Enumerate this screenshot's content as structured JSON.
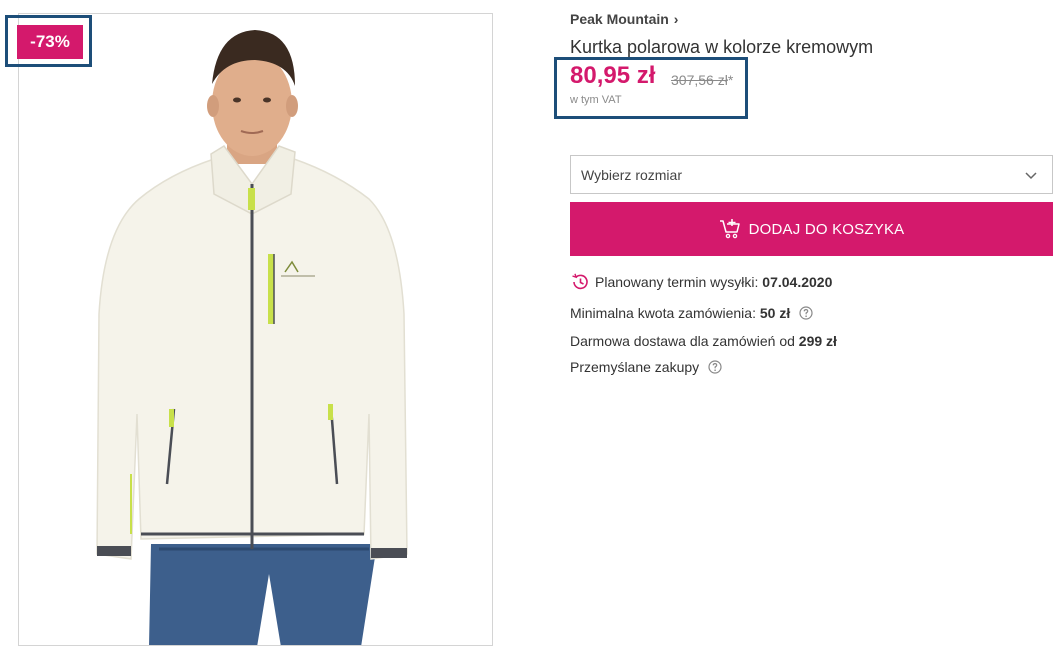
{
  "badge": {
    "discount": "-73%"
  },
  "product": {
    "brand": "Peak Mountain",
    "brand_chevron": "›",
    "title": "Kurtka polarowa w kolorze kremowym",
    "price_current": "80,95 zł",
    "price_old": "307,56 zł",
    "price_old_asterisk": "*",
    "vat_note": "w tym VAT"
  },
  "size_select": {
    "placeholder": "Wybierz rozmiar"
  },
  "cart_button": {
    "label": "DODAJ DO KOSZYKA",
    "icon": "cart-plus-icon"
  },
  "info": {
    "shipping_label": "Planowany termin wysyłki:",
    "shipping_date": "07.04.2020",
    "min_order_label": "Minimalna kwota zamówienia:",
    "min_order_value": "50 zł",
    "free_delivery_label": "Darmowa dostawa dla zamówień od",
    "free_delivery_value": "299 zł",
    "thoughtful_label": "Przemyślane zakupy"
  },
  "colors": {
    "accent": "#d4196c",
    "outline": "#1d4e79",
    "border": "#d4d4d4"
  },
  "image": {
    "description_icon": "product-photo"
  }
}
